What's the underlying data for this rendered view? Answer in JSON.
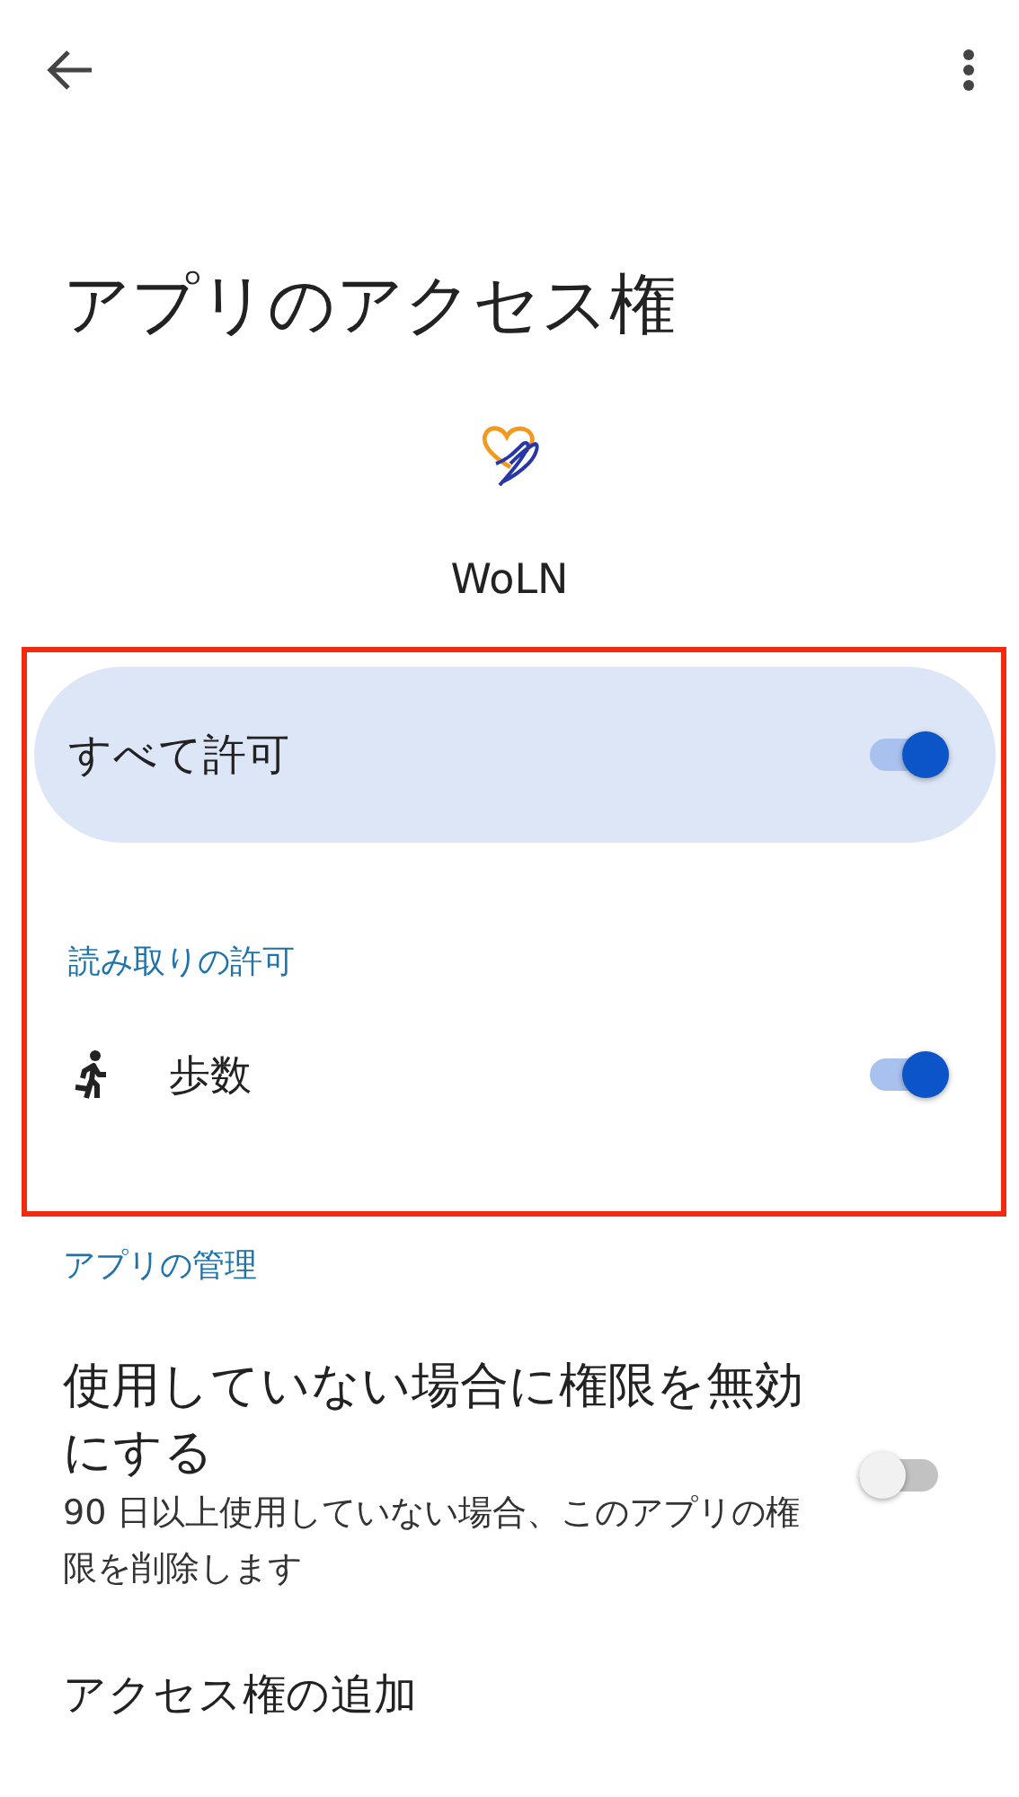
{
  "top_bar": {
    "back": true,
    "more": true
  },
  "title": "アプリのアクセス権",
  "app": {
    "name": "WoLN"
  },
  "highlight_frame": true,
  "all_allow": {
    "label": "すべて許可",
    "on": true
  },
  "read_section": {
    "header": "読み取りの許可",
    "items": [
      {
        "label": "歩数",
        "kind": "steps",
        "on": true
      }
    ]
  },
  "manage_section": {
    "header": "アプリの管理",
    "items": [
      {
        "kind": "toggle",
        "title": "使用していない場合に権限を無効にする",
        "subtitle": "90 日以上使用していない場合、このアプリの権限を削除します",
        "on": false
      },
      {
        "kind": "link",
        "title": "アクセス権の追加"
      }
    ]
  }
}
